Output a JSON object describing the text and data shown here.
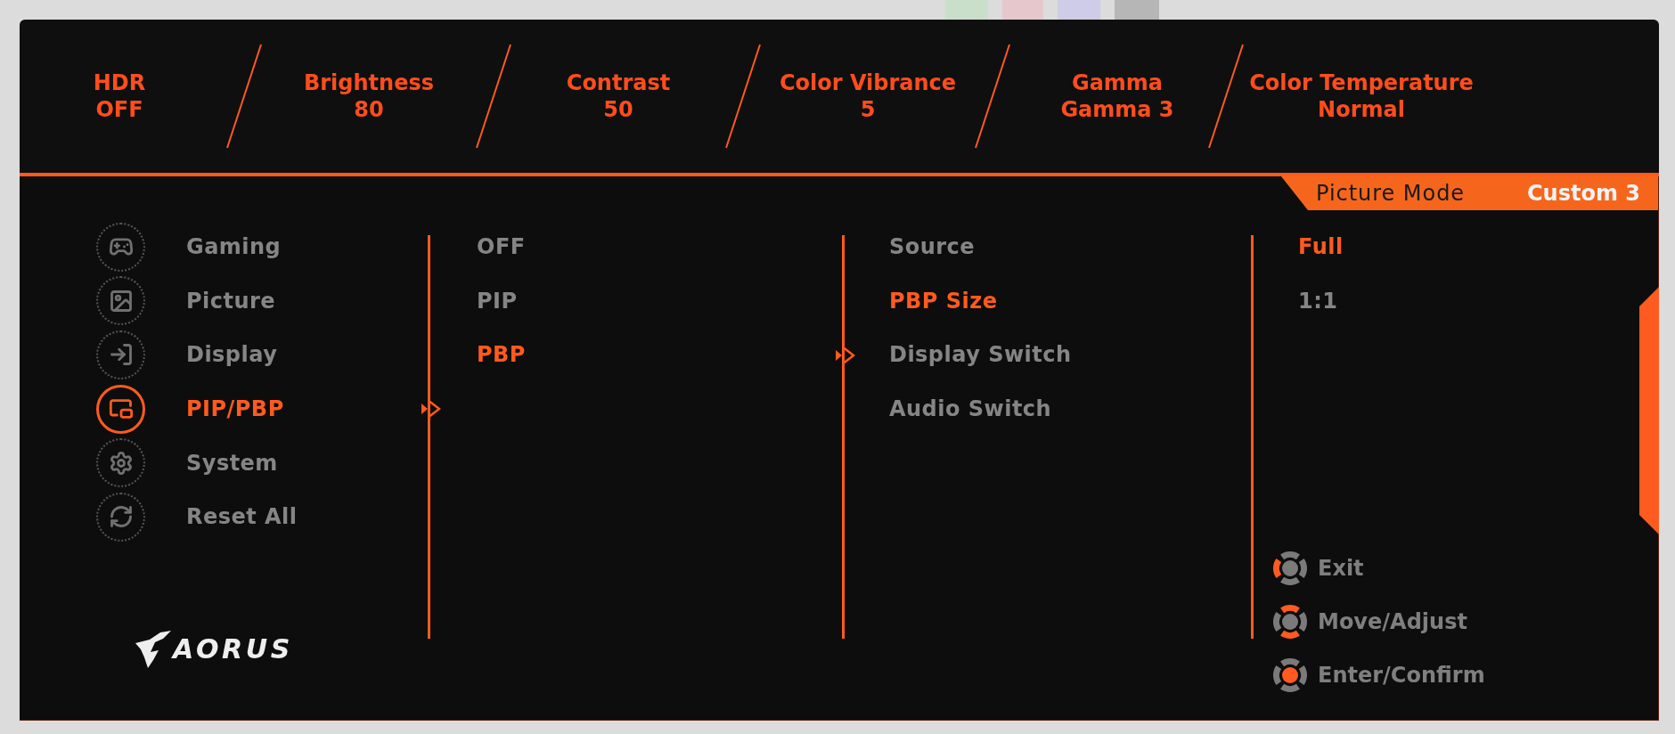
{
  "top_bar": {
    "items": [
      {
        "label": "HDR",
        "value": "OFF"
      },
      {
        "label": "Brightness",
        "value": "80"
      },
      {
        "label": "Contrast",
        "value": "50"
      },
      {
        "label": "Color Vibrance",
        "value": "5"
      },
      {
        "label": "Gamma",
        "value": "Gamma 3"
      },
      {
        "label": "Color Temperature",
        "value": "Normal"
      }
    ]
  },
  "picture_mode": {
    "label": "Picture Mode",
    "value": "Custom 3"
  },
  "main_menu": {
    "items": [
      {
        "label": "Gaming",
        "selected": false
      },
      {
        "label": "Picture",
        "selected": false
      },
      {
        "label": "Display",
        "selected": false
      },
      {
        "label": "PIP/PBP",
        "selected": true
      },
      {
        "label": "System",
        "selected": false
      },
      {
        "label": "Reset All",
        "selected": false
      }
    ]
  },
  "submenu": {
    "items": [
      {
        "label": "OFF",
        "selected": false
      },
      {
        "label": "PIP",
        "selected": false
      },
      {
        "label": "PBP",
        "selected": true
      }
    ]
  },
  "options": {
    "items": [
      {
        "label": "Source",
        "selected": false
      },
      {
        "label": "PBP Size",
        "selected": true
      },
      {
        "label": "Display Switch",
        "selected": false
      },
      {
        "label": "Audio Switch",
        "selected": false
      }
    ]
  },
  "values": {
    "items": [
      {
        "label": "Full",
        "selected": true
      },
      {
        "label": "1:1",
        "selected": false
      }
    ]
  },
  "logo": {
    "text": "AORUS"
  },
  "legend": {
    "items": [
      {
        "label": "Exit"
      },
      {
        "label": "Move/Adjust"
      },
      {
        "label": "Enter/Confirm"
      }
    ]
  }
}
